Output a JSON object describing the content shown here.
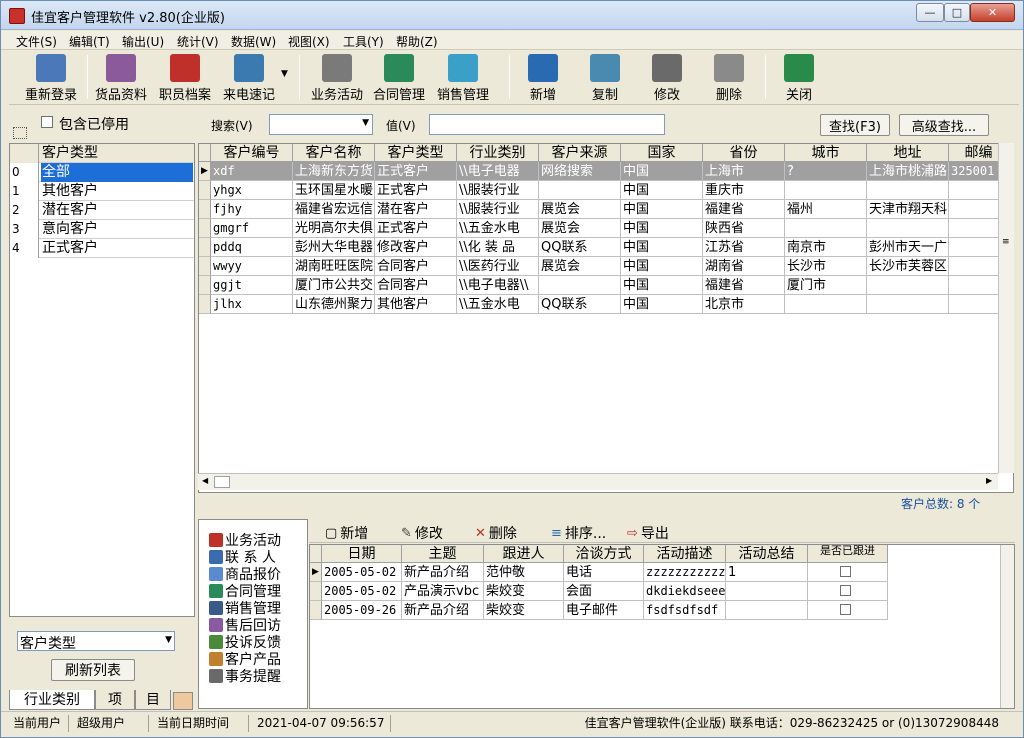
{
  "window": {
    "title": "佳宜客户管理软件 v2.80(企业版)",
    "minimize": "—",
    "maximize": "□",
    "close": "✕"
  },
  "menu": [
    "文件(S)",
    "编辑(T)",
    "输出(U)",
    "统计(V)",
    "数据(W)",
    "视图(X)",
    "工具(Y)",
    "帮助(Z)"
  ],
  "toolbar": [
    {
      "label": "重新登录",
      "icon": "relogin-icon",
      "color": "#4a78b8"
    },
    {
      "label": "货品资料",
      "icon": "goods-icon",
      "color": "#8a5a9a"
    },
    {
      "label": "职员档案",
      "icon": "staff-icon",
      "color": "#c0302a"
    },
    {
      "label": "来电速记",
      "icon": "phone-icon",
      "color": "#3a7ab0"
    },
    {
      "label": "业务活动",
      "icon": "activity-icon",
      "color": "#7a7a7a"
    },
    {
      "label": "合同管理",
      "icon": "contract-icon",
      "color": "#2a8a5a"
    },
    {
      "label": "销售管理",
      "icon": "sales-chart-icon",
      "color": "#3aa0c8"
    },
    {
      "label": "新增",
      "icon": "new-icon",
      "color": "#2a6ab0"
    },
    {
      "label": "复制",
      "icon": "copy-icon",
      "color": "#4a8ab0"
    },
    {
      "label": "修改",
      "icon": "edit-icon",
      "color": "#6a6a6a"
    },
    {
      "label": "删除",
      "icon": "delete-icon",
      "color": "#8a8a8a"
    },
    {
      "label": "关闭",
      "icon": "exit-icon",
      "color": "#2a8a4a"
    }
  ],
  "search": {
    "include_disabled": "包含已停用",
    "search_label": "搜索(V)",
    "value_label": "值(V)",
    "find_button": "查找(F3)",
    "advanced_button": "高级查找..."
  },
  "left": {
    "header": "客户类型",
    "rows": [
      {
        "num": "0",
        "text": "全部",
        "selected": true
      },
      {
        "num": "1",
        "text": "其他客户"
      },
      {
        "num": "2",
        "text": "潜在客户"
      },
      {
        "num": "3",
        "text": "意向客户"
      },
      {
        "num": "4",
        "text": "正式客户"
      }
    ],
    "filter_select": "客户类型",
    "refresh_button": "刷新列表",
    "tabs": [
      "行业类别",
      "项",
      "目"
    ]
  },
  "grid": {
    "columns": [
      "客户编号",
      "客户名称",
      "客户类型",
      "行业类别",
      "客户来源",
      "国家",
      "省份",
      "城市",
      "地址",
      "邮编"
    ],
    "rows": [
      [
        "xdf",
        "上海新东方货",
        "正式客户",
        "\\\\电子电器",
        "网络搜索",
        "中国",
        "上海市",
        "?",
        "上海市桃浦路",
        "325001"
      ],
      [
        "yhgx",
        "玉环国星水暖",
        "正式客户",
        "\\\\服装行业",
        "",
        "中国",
        "重庆市",
        "",
        "",
        ""
      ],
      [
        "fjhy",
        "福建省宏远信",
        "潜在客户",
        "\\\\服装行业",
        "展览会",
        "中国",
        "福建省",
        "福州",
        "天津市翔天科",
        ""
      ],
      [
        "gmgrf",
        "光明高尔夫俱",
        "正式客户",
        "\\\\五金水电",
        "展览会",
        "中国",
        "陕西省",
        "",
        "",
        ""
      ],
      [
        "pddq",
        "彭州大华电器",
        "修改客户",
        "\\\\化 装 品",
        "QQ联系",
        "中国",
        "江苏省",
        "南京市",
        "彭州市天一广",
        ""
      ],
      [
        "wwyy",
        "湖南旺旺医院",
        "合同客户",
        "\\\\医药行业",
        "展览会",
        "中国",
        "湖南省",
        "长沙市",
        "长沙市芙蓉区",
        ""
      ],
      [
        "ggjt",
        "厦门市公共交",
        "合同客户",
        "\\\\电子电器\\\\",
        "",
        "中国",
        "福建省",
        "厦门市",
        "",
        ""
      ],
      [
        "jlhx",
        "山东德州聚力",
        "其他客户",
        "\\\\五金水电",
        "QQ联系",
        "中国",
        "北京市",
        "",
        "",
        ""
      ]
    ],
    "total_label": "客户总数: 8 个"
  },
  "biz_list": [
    {
      "label": "业务活动",
      "icon": "activity-icon",
      "color": "#c0302a"
    },
    {
      "label": "联 系 人",
      "icon": "contact-icon",
      "color": "#3a6ab0"
    },
    {
      "label": "商品报价",
      "icon": "quote-icon",
      "color": "#5a8ad0"
    },
    {
      "label": "合同管理",
      "icon": "contract-icon",
      "color": "#2a8a5a"
    },
    {
      "label": "销售管理",
      "icon": "sales-icon",
      "color": "#3a5a8a"
    },
    {
      "label": "售后回访",
      "icon": "revisit-icon",
      "color": "#8a5aa0"
    },
    {
      "label": "投诉反馈",
      "icon": "feedback-icon",
      "color": "#4a8a3a"
    },
    {
      "label": "客户产品",
      "icon": "product-icon",
      "color": "#c08030"
    },
    {
      "label": "事务提醒",
      "icon": "reminder-icon",
      "color": "#6a6a6a"
    }
  ],
  "sub_toolbar": [
    {
      "label": "新增",
      "icon": "new-doc-icon"
    },
    {
      "label": "修改",
      "icon": "edit-icon"
    },
    {
      "label": "删除",
      "icon": "delete-x-icon"
    },
    {
      "label": "排序...",
      "icon": "sort-icon"
    },
    {
      "label": "导出",
      "icon": "export-icon"
    }
  ],
  "subgrid": {
    "columns": [
      "日期",
      "主题",
      "跟进人",
      "洽谈方式",
      "活动描述",
      "活动总结",
      "是否已跟进"
    ],
    "rows": [
      [
        "2005-05-02",
        "新产品介绍",
        "范仲敬",
        "电话",
        "zzzzzzzzzzz",
        "1"
      ],
      [
        "2005-05-02",
        "产品演示vbc",
        "柴姣变",
        "会面",
        "dkdiekdseee",
        ""
      ],
      [
        "2005-09-26",
        "新产品介绍",
        "柴姣变",
        "电子邮件",
        "fsdfsdfsdf",
        ""
      ]
    ]
  },
  "status": {
    "user_label": "当前用户",
    "user_value": "超级用户",
    "date_label": "当前日期时间",
    "date_value": "2021-04-07 09:56:57",
    "info": "佳宜客户管理软件(企业版) 联系电话：029-86232425 or (0)13072908448"
  }
}
